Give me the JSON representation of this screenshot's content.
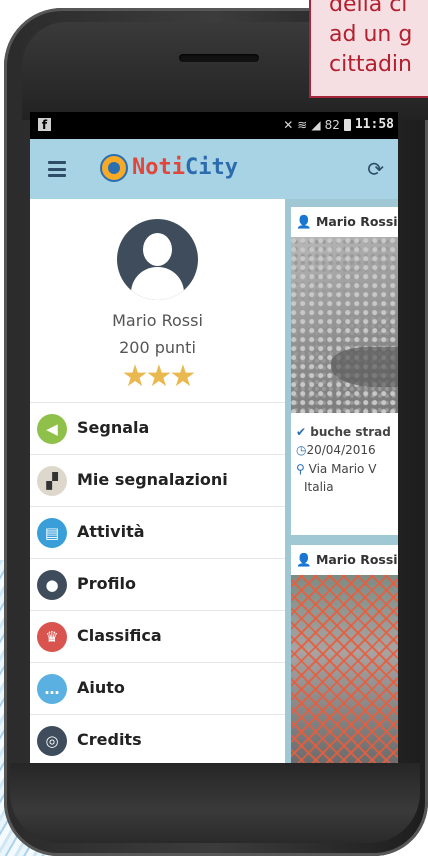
{
  "callout": {
    "lines": [
      "della ci",
      "ad un g",
      "cittadin"
    ]
  },
  "statusbar": {
    "left_icon": "facebook-icon",
    "battery": "82",
    "time": "11:58"
  },
  "appbar": {
    "logo_part1": "Noti",
    "logo_part2": "City",
    "colors": {
      "bar": "#a8d3e4",
      "logo_red": "#e2463a",
      "logo_blue": "#2c6cae"
    }
  },
  "profile": {
    "name": "Mario Rossi",
    "points": "200 punti",
    "stars": 3
  },
  "menu": [
    {
      "label": "Segnala",
      "icon": "megaphone-icon",
      "color": "#8fc14a",
      "glyph": "📢"
    },
    {
      "label": "Mie segnalazioni",
      "icon": "roadblock-icon",
      "color": "#c9c3b8",
      "glyph": "▰"
    },
    {
      "label": "Attività",
      "icon": "clipboard-icon",
      "color": "#3a9fd8",
      "glyph": "▤"
    },
    {
      "label": "Profilo",
      "icon": "user-icon",
      "color": "#3e4c5c",
      "glyph": "●"
    },
    {
      "label": "Classifica",
      "icon": "trophy-icon",
      "color": "#d9534f",
      "glyph": "🏆"
    },
    {
      "label": "Aiuto",
      "icon": "chat-icon",
      "color": "#5ab0e0",
      "glyph": "…"
    },
    {
      "label": "Credits",
      "icon": "rings-icon",
      "color": "#3e4c5c",
      "glyph": "◎"
    }
  ],
  "feed": {
    "cards": [
      {
        "author": "Mario Rossi",
        "category": "buche strad",
        "date": "20/04/2016",
        "address": "Via Mario V",
        "country": "Italia"
      },
      {
        "author": "Mario Rossi"
      }
    ]
  }
}
